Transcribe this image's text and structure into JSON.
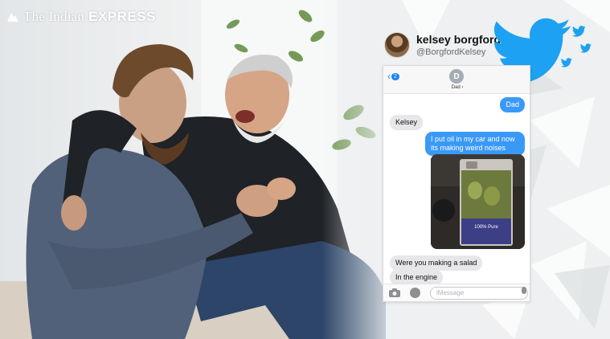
{
  "watermark": {
    "brand_light": "The Indian",
    "brand_bold": "EXPRESS"
  },
  "tweet": {
    "display_name": "kelsey borgford",
    "handle": "@BorgfordKelsey"
  },
  "imessage": {
    "back_badge": "2",
    "contact_initial": "D",
    "contact_name": "Dad",
    "messages": [
      {
        "dir": "out",
        "text": "Dad"
      },
      {
        "dir": "in",
        "text": "Kelsey"
      },
      {
        "dir": "out",
        "text": "I put oil in my car and now its making weird noises"
      },
      {
        "dir": "in",
        "text": "Were you making a salad"
      },
      {
        "dir": "in",
        "text": "In the engine"
      }
    ],
    "photo_label_brand": "100% Pure",
    "input_placeholder": "iMessage"
  },
  "colors": {
    "twitter_blue": "#1da1f2",
    "imessage_blue": "#3a99f7",
    "bubble_gray": "#e7e7ea"
  },
  "icons": [
    "twitter-bird-icon",
    "camera-icon",
    "app-store-icon",
    "microphone-icon",
    "back-chevron-icon"
  ]
}
